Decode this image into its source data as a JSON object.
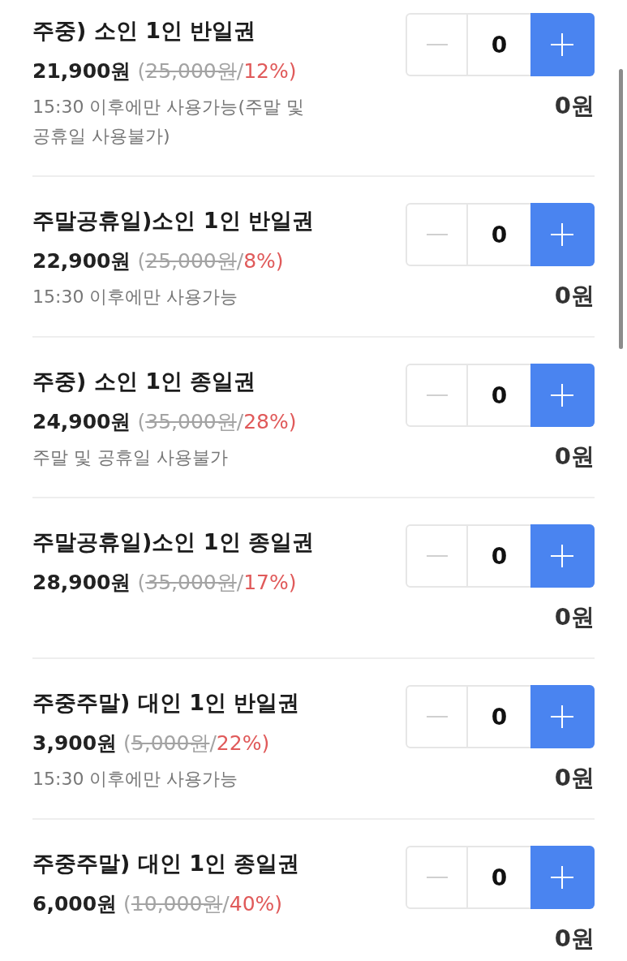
{
  "products": [
    {
      "name": "주중) 소인 1인 반일권",
      "price": "21,900원",
      "open": "(",
      "list_price": "25,000원",
      "separator": "/",
      "discount": "12%)",
      "note": "15:30 이후에만 사용가능(주말 및 공휴일 사용불가)",
      "quantity": "0",
      "minus_disabled": true,
      "total": "0원"
    },
    {
      "name": "주말공휴일)소인 1인 반일권",
      "price": "22,900원",
      "open": "(",
      "list_price": "25,000원",
      "separator": "/",
      "discount": "8%)",
      "note": "15:30 이후에만 사용가능",
      "quantity": "0",
      "minus_disabled": true,
      "total": "0원"
    },
    {
      "name": "주중) 소인 1인 종일권",
      "price": "24,900원",
      "open": "(",
      "list_price": "35,000원",
      "separator": "/",
      "discount": "28%)",
      "note": "주말 및 공휴일 사용불가",
      "quantity": "0",
      "minus_disabled": true,
      "total": "0원"
    },
    {
      "name": "주말공휴일)소인 1인 종일권",
      "price": "28,900원",
      "open": "(",
      "list_price": "35,000원",
      "separator": "/",
      "discount": "17%)",
      "quantity": "0",
      "minus_disabled": true,
      "total": "0원"
    },
    {
      "name": "주중주말) 대인 1인 반일권",
      "price": "3,900원",
      "open": "(",
      "list_price": "5,000원",
      "separator": "/",
      "discount": "22%)",
      "note": "15:30 이후에만 사용가능",
      "quantity": "0",
      "minus_disabled": true,
      "total": "0원"
    },
    {
      "name": "주중주말) 대인 1인 종일권",
      "price": "6,000원",
      "open": "(",
      "list_price": "10,000원",
      "separator": "/",
      "discount": "40%)",
      "quantity": "0",
      "minus_disabled": true,
      "total": "0원"
    }
  ]
}
